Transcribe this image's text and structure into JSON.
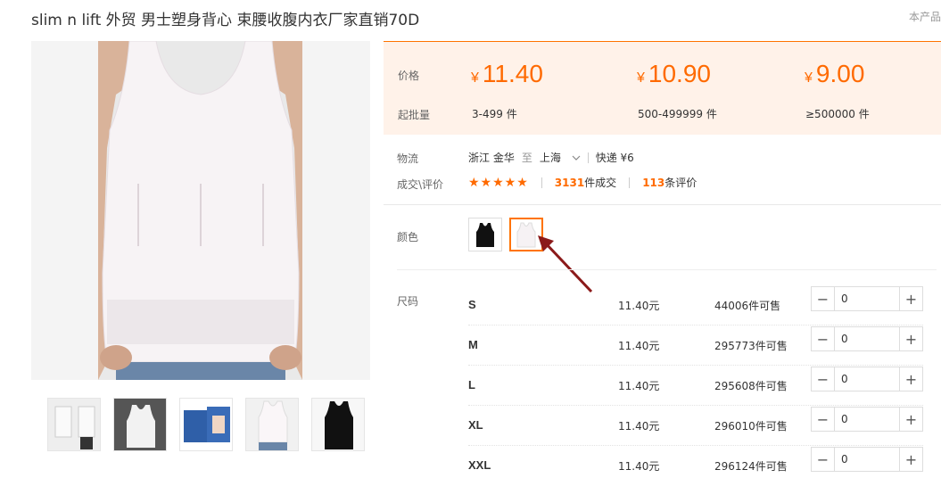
{
  "product": {
    "title": "slim n lift 外贸 男士塑身背心 束腰收腹内衣厂家直销70D",
    "top_right": "本产品"
  },
  "gallery": {
    "main_image": "white-shapewear-vest-photo",
    "thumbnails": [
      "two-men-white-vest",
      "white-vest-on-dark",
      "vest-product-box",
      "white-vest-front",
      "black-vest-front"
    ]
  },
  "pricing": {
    "price_label": "价格",
    "min_qty_label": "起批量",
    "currency": "¥",
    "tiers": [
      {
        "price": "11.40",
        "range": "3-499",
        "unit": "件"
      },
      {
        "price": "10.90",
        "range": "500-499999",
        "unit": "件"
      },
      {
        "price": "9.00",
        "range": "≥500000",
        "unit": "件"
      }
    ],
    "accent_color": "#ff6a00"
  },
  "logistics": {
    "label": "物流",
    "from": "浙江 金华",
    "to_word": "至",
    "to": "上海",
    "express": "快递 ¥6"
  },
  "reviews": {
    "label": "成交\\评价",
    "stars": "★★★★★",
    "deals_count": "3131",
    "deals_text": "件成交",
    "review_count": "113",
    "review_text": "条评价"
  },
  "color": {
    "label": "颜色",
    "options": [
      "black-vest",
      "white-vest"
    ],
    "selected": "white-vest"
  },
  "sizes": {
    "label": "尺码",
    "rows": [
      {
        "size": "S",
        "price": "11.40元",
        "stock": "44006件可售",
        "qty": "0"
      },
      {
        "size": "M",
        "price": "11.40元",
        "stock": "295773件可售",
        "qty": "0"
      },
      {
        "size": "L",
        "price": "11.40元",
        "stock": "295608件可售",
        "qty": "0"
      },
      {
        "size": "XL",
        "price": "11.40元",
        "stock": "296010件可售",
        "qty": "0"
      },
      {
        "size": "XXL",
        "price": "11.40元",
        "stock": "296124件可售",
        "qty": "0"
      }
    ]
  }
}
